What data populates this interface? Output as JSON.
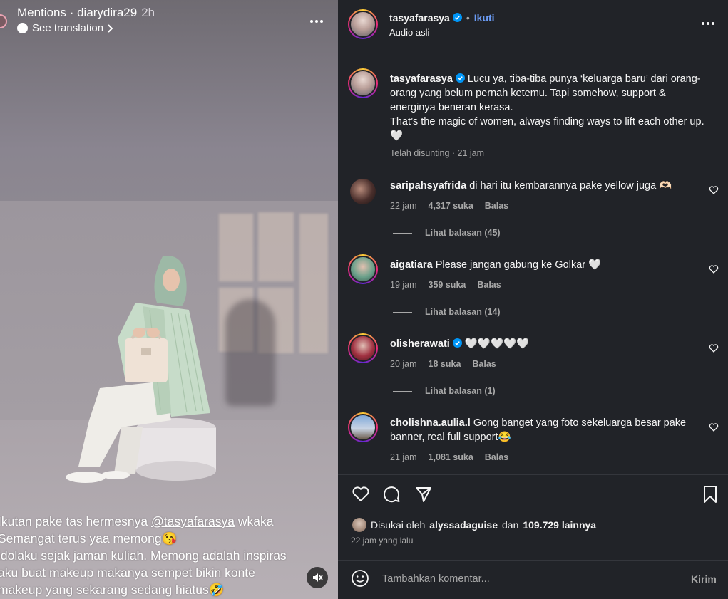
{
  "story": {
    "title": "Mentions · diarydira29",
    "time": "2h",
    "see_translation": "See translation",
    "caption": {
      "line1_pre": "Ikutan pake tas hermesnya ",
      "line1_mention": "@tasyafarasya",
      "line1_post": " wkaka",
      "line2": "Semangat terus yaa memong😘",
      "line3": "idolaku sejak jaman kuliah. Memong adalah inspiras",
      "line4": "aku buat makeup makanya sempet bikin konte",
      "line5": "makeup yang sekarang sedang hiatus🤣"
    }
  },
  "post": {
    "author": "tasyafarasya",
    "dot": "•",
    "follow_label": "Ikuti",
    "audio": "Audio asli",
    "caption": {
      "author": "tasyafarasya",
      "text_1": "Lucu ya, tiba-tiba punya ‘keluarga baru’ dari orang-orang yang belum pernah ketemu. Tapi somehow, support & energinya beneran kerasa.",
      "text_2": "That’s the magic of women, always finding ways to lift each other up. 🤍",
      "meta": "Telah disunting · 21 jam"
    },
    "comments": [
      {
        "username": "saripahsyafrida",
        "text": "di hari itu kembarannya pake yellow juga 🫶🏻",
        "time": "22 jam",
        "likes": "4,317 suka",
        "reply": "Balas",
        "view_replies": "Lihat balasan (45)"
      },
      {
        "username": "aigatiara",
        "text": "Please jangan gabung ke Golkar 🤍",
        "time": "19 jam",
        "likes": "359 suka",
        "reply": "Balas",
        "view_replies": "Lihat balasan (14)"
      },
      {
        "username": "olisherawati",
        "text": "🤍🤍🤍🤍🤍",
        "time": "20 jam",
        "likes": "18 suka",
        "reply": "Balas",
        "view_replies": "Lihat balasan (1)"
      },
      {
        "username": "cholishna.aulia.l",
        "text": "Gong banget yang foto sekeluarga besar pake banner, real full support😂",
        "time": "21 jam",
        "likes": "1,081 suka",
        "reply": "Balas"
      }
    ],
    "likes_prefix": "Disukai oleh",
    "likes_user": "alyssadaguise",
    "likes_mid": "dan",
    "likes_count": "109.729 lainnya",
    "posted": "22 jam yang lalu",
    "comment_placeholder": "Tambahkan komentar...",
    "post_label": "Kirim"
  }
}
